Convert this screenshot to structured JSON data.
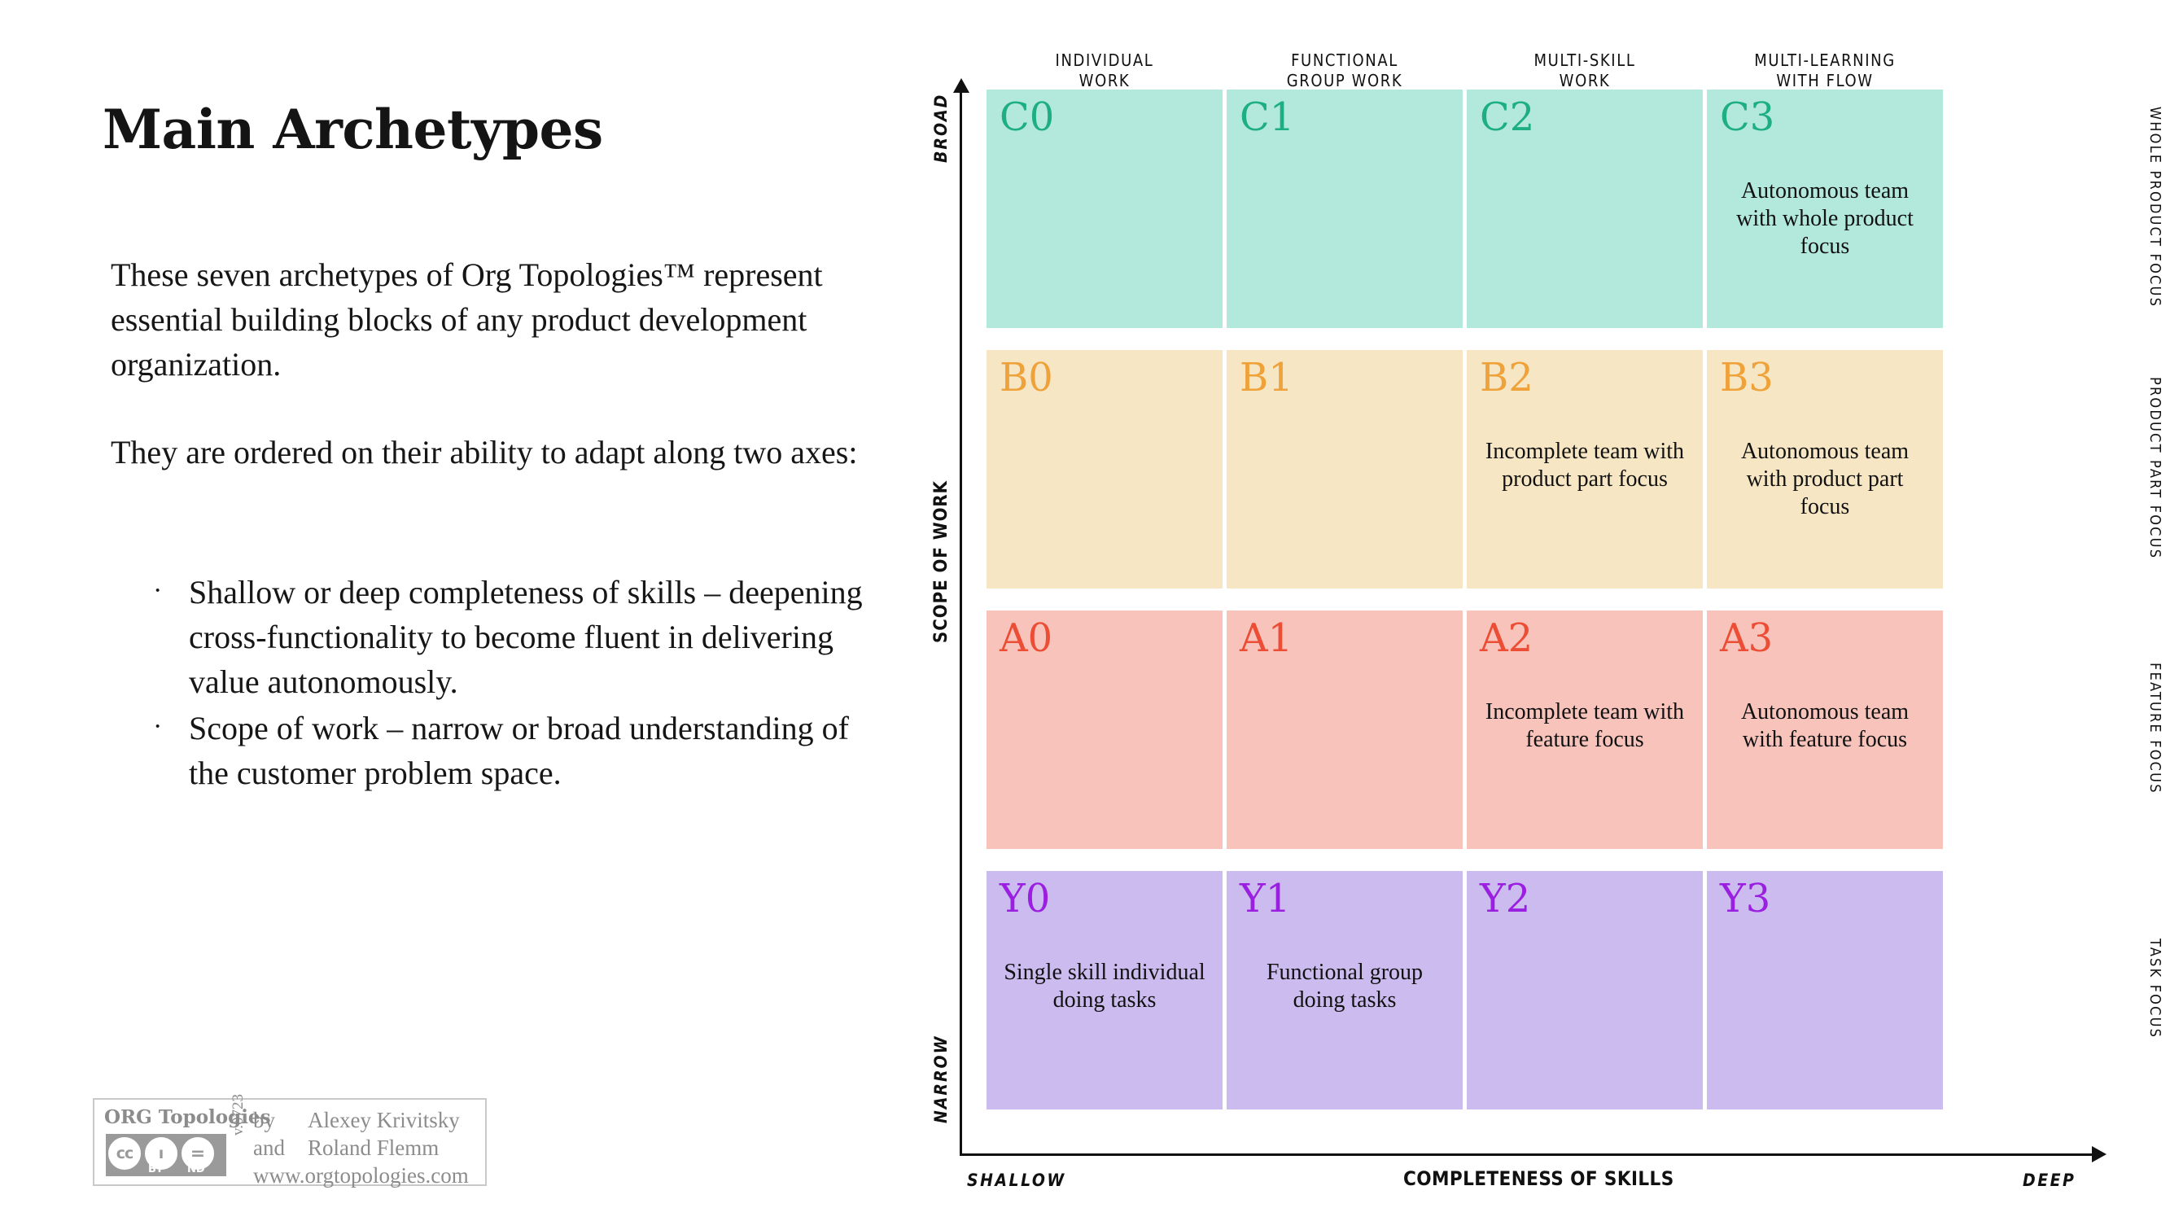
{
  "slide": {
    "title": "Main Archetypes",
    "paragraphs": [
      "These seven archetypes of Org Topologies™ represent essential building blocks of any product development organization.",
      "They are ordered on their ability to adapt along two axes:"
    ],
    "bullets": [
      "Shallow or deep completeness of skills – deepening cross-functionality to become fluent in delivering value autonomously.",
      "Scope of work – narrow or broad understanding of the customer problem space."
    ],
    "bullet_marker": "·"
  },
  "licence": {
    "brand": "ORG Topologies",
    "cc_label": "cc",
    "by_label": "BY",
    "nd_label": "ND",
    "by_person_glyph": "ı",
    "nd_glyph": "=",
    "version": "v.0723",
    "by_word": "by",
    "and_word": "and",
    "author_1": "Alexey Krivitsky",
    "author_2": "Roland Flemm",
    "url": "www.orgtopologies.com"
  },
  "chart_data": {
    "type": "heatmap",
    "title": "Main Archetypes",
    "xlabel": "COMPLETENESS OF SKILLS",
    "ylabel": "SCOPE OF WORK",
    "x_axis_start": "SHALLOW",
    "x_axis_end": "DEEP",
    "y_axis_start": "NARROW",
    "y_axis_end": "BROAD",
    "grid": false,
    "categories": [
      "INDIVIDUAL WORK",
      "FUNCTIONAL GROUP WORK",
      "MULTI-SKILL WORK",
      "MULTI-LEARNING WITH FLOW"
    ],
    "column_headers": [
      [
        "INDIVIDUAL",
        "WORK"
      ],
      [
        "FUNCTIONAL",
        "GROUP WORK"
      ],
      [
        "MULTI-SKILL",
        "WORK"
      ],
      [
        "MULTI-LEARNING",
        "WITH FLOW"
      ]
    ],
    "row_labels": [
      [
        "WHOLE PRODUCT",
        "FOCUS"
      ],
      [
        "PRODUCT",
        "PART FOCUS"
      ],
      [
        "FEATURE",
        "FOCUS"
      ],
      [
        "TASK",
        "FOCUS"
      ]
    ],
    "rows": [
      {
        "row_id": "C",
        "fill": "#b3e8dc",
        "code_color": "#1eae84",
        "row_label": "WHOLE PRODUCT FOCUS",
        "cells": [
          {
            "code": "C0",
            "desc": ""
          },
          {
            "code": "C1",
            "desc": ""
          },
          {
            "code": "C2",
            "desc": ""
          },
          {
            "code": "C3",
            "desc": "Autonomous team with whole product focus"
          }
        ]
      },
      {
        "row_id": "B",
        "fill": "#f7e6c4",
        "code_color": "#efa239",
        "row_label": "PRODUCT PART FOCUS",
        "cells": [
          {
            "code": "B0",
            "desc": ""
          },
          {
            "code": "B1",
            "desc": ""
          },
          {
            "code": "B2",
            "desc": "Incomplete team with\nproduct part focus"
          },
          {
            "code": "B3",
            "desc": "Autonomous team with product part focus"
          }
        ]
      },
      {
        "row_id": "A",
        "fill": "#f7c3bb",
        "code_color": "#ec4d35",
        "row_label": "FEATURE FOCUS",
        "cells": [
          {
            "code": "A0",
            "desc": ""
          },
          {
            "code": "A1",
            "desc": ""
          },
          {
            "code": "A2",
            "desc": "Incomplete team with feature focus"
          },
          {
            "code": "A3",
            "desc": "Autonomous team with feature focus"
          }
        ]
      },
      {
        "row_id": "Y",
        "fill": "#cbbbee",
        "code_color": "#9b1fe0",
        "row_label": "TASK FOCUS",
        "cells": [
          {
            "code": "Y0",
            "desc": "Single skill individual doing tasks"
          },
          {
            "code": "Y1",
            "desc": "Functional group doing tasks"
          },
          {
            "code": "Y2",
            "desc": ""
          },
          {
            "code": "Y3",
            "desc": ""
          }
        ]
      }
    ]
  }
}
